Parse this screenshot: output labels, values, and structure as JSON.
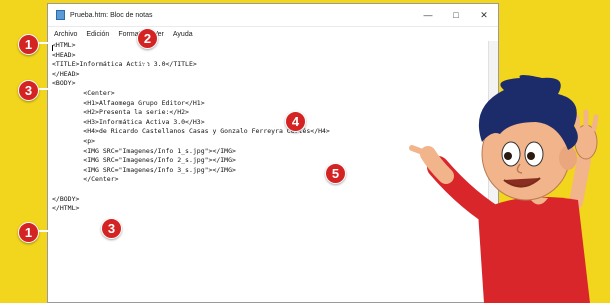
{
  "window": {
    "title": "Prueba.htm: Bloc de notas",
    "controls": {
      "minimize": "—",
      "maximize": "□",
      "close": "✕"
    }
  },
  "menu": [
    "Archivo",
    "Edición",
    "Formato",
    "Ver",
    "Ayuda"
  ],
  "code_lines": [
    "<HTML>",
    "<HEAD>",
    "<TITLE>Informática Activa 3.0</TITLE>",
    "</HEAD>",
    "<BODY>",
    "        <Center>",
    "        <H1>Alfaomega Grupo Editor</H1>",
    "        <H2>Presenta la serie:</H2>",
    "        <H3>Informática Activa 3.0</H3>",
    "        <H4>de Ricardo Castellanos Casas y Gonzalo Ferreyra Cortés</H4>",
    "        <p>",
    "        <IMG SRC=\"Imagenes/Info 1_s.jpg\"></IMG>",
    "        <IMG SRC=\"Imagenes/Info 2_s.jpg\"></IMG>",
    "        <IMG SRC=\"Imagenes/Info 3_s.jpg\"></IMG>",
    "        </Center>",
    "",
    "</BODY>",
    "</HTML>"
  ],
  "markers": {
    "m1_top": "1",
    "m2": "2",
    "m3_top": "3",
    "m4": "4",
    "m5": "5",
    "m1_bottom": "1",
    "m3_bottom": "3"
  },
  "colors": {
    "marker": "#d42323",
    "background": "#f2d51d"
  }
}
